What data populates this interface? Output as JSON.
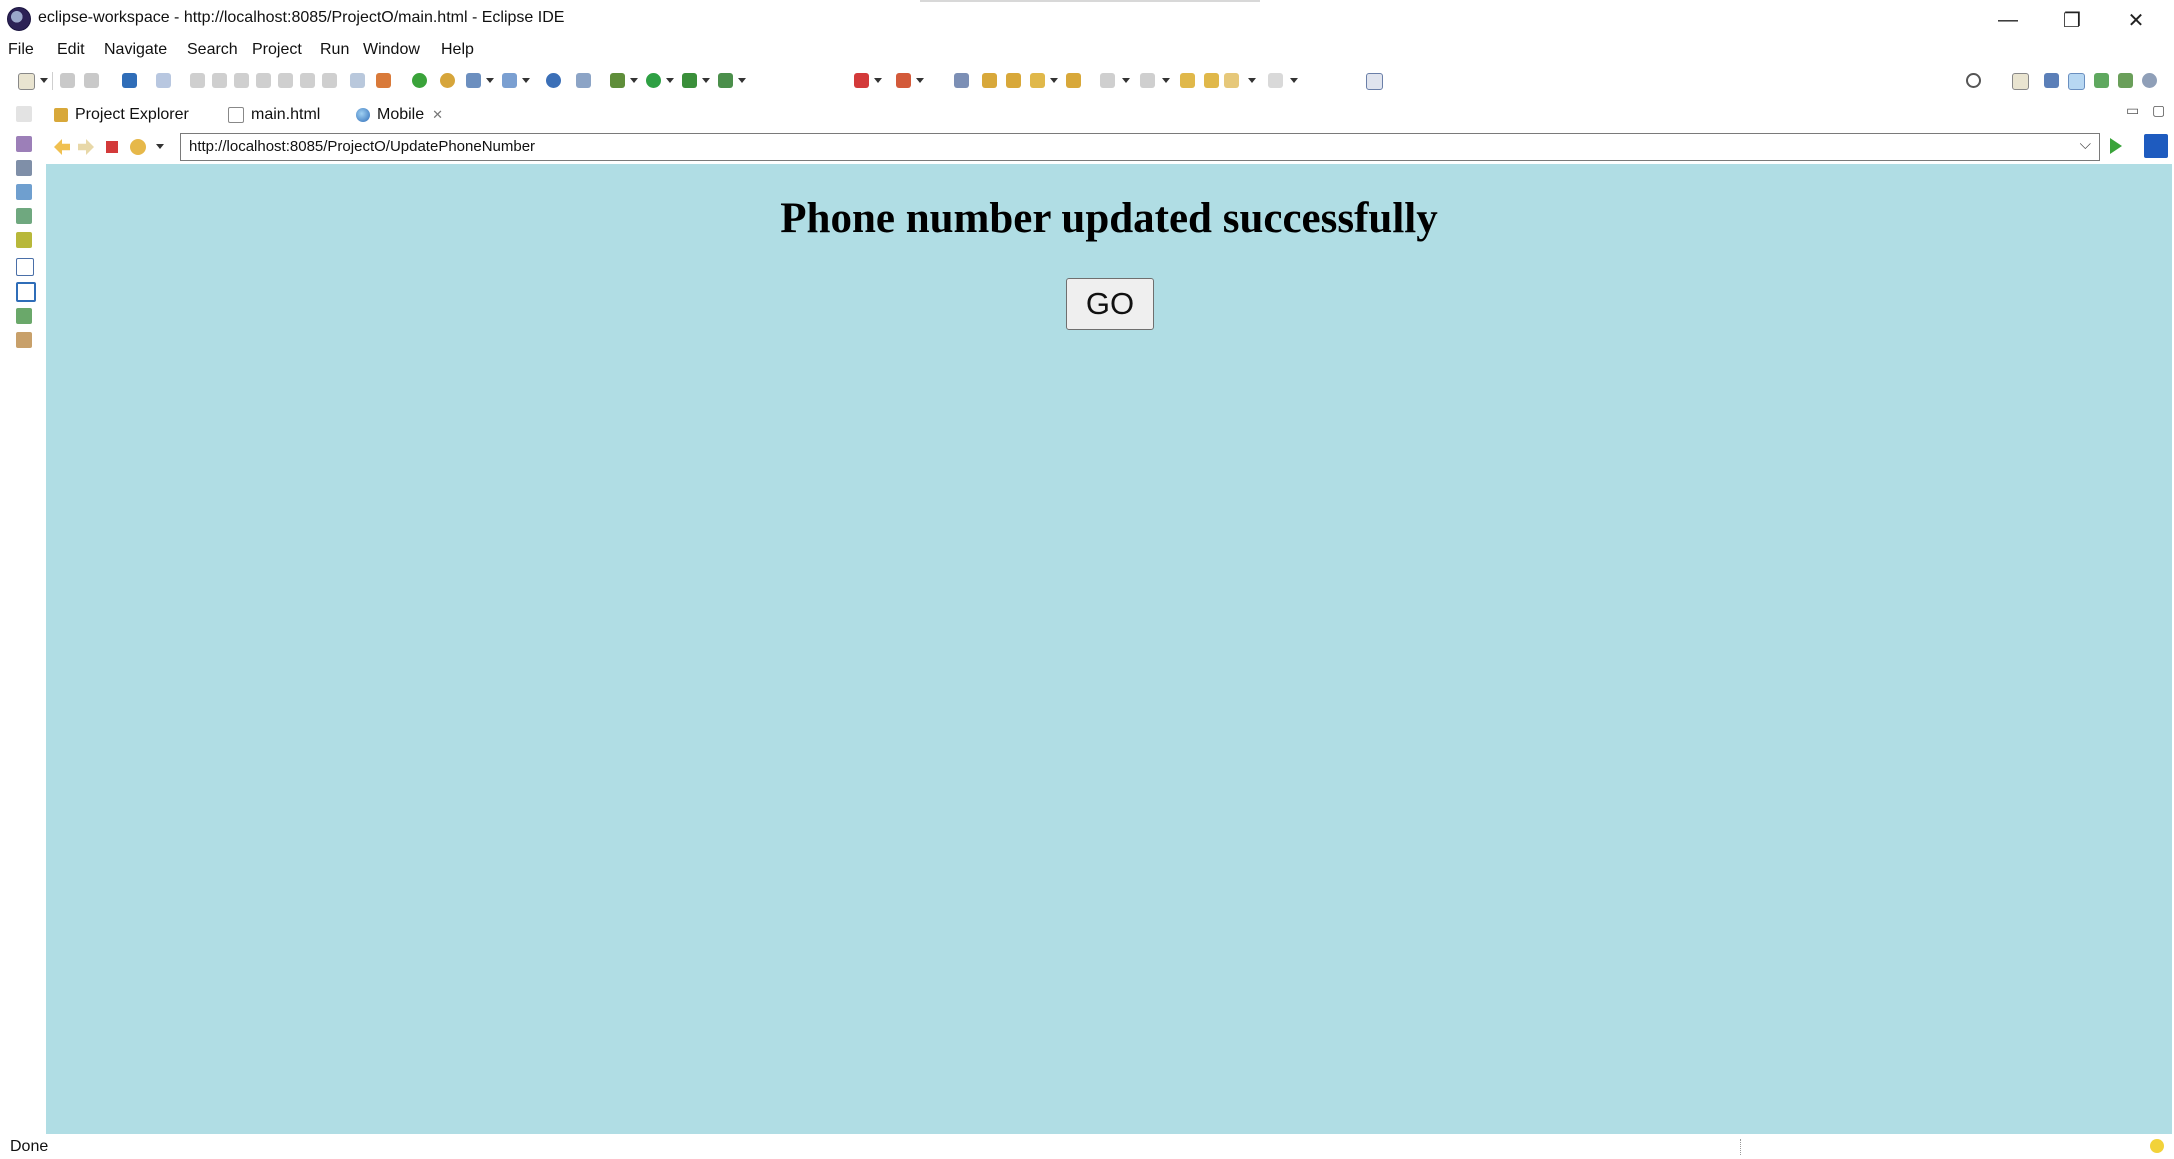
{
  "window": {
    "title": "eclipse-workspace - http://localhost:8085/ProjectO/main.html - Eclipse IDE",
    "minimize": "—",
    "restore": "❐",
    "close": "✕"
  },
  "menu": [
    "File",
    "Edit",
    "Navigate",
    "Search",
    "Project",
    "Run",
    "Window",
    "Help"
  ],
  "tabs": [
    {
      "label": "Project Explorer",
      "icon": "project-explorer-icon"
    },
    {
      "label": "main.html",
      "icon": "html-file-icon"
    },
    {
      "label": "Mobile",
      "icon": "globe-icon",
      "active": true,
      "close": "✕"
    }
  ],
  "browser": {
    "url": "http://localhost:8085/ProjectO/UpdatePhoneNumber",
    "dropdown": "⌵"
  },
  "content": {
    "heading": "Phone number updated successfully",
    "button_label": "GO",
    "background": "#b0dde4"
  },
  "status": {
    "text": "Done"
  },
  "colors": {
    "page_bg": "#b0dde4",
    "go_arrow": "#3aa33a",
    "stop": "#d33a3a"
  }
}
